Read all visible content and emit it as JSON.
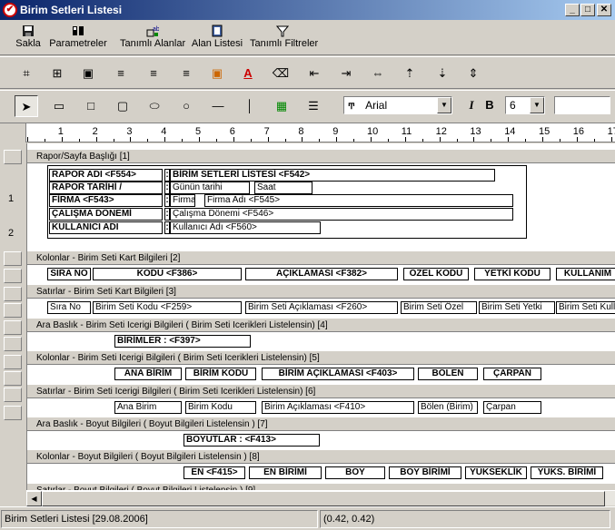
{
  "window": {
    "title": "Birim Setleri Listesi"
  },
  "toolbar_main": [
    {
      "label": "Sakla",
      "icon": "save-icon"
    },
    {
      "label": "Parametreler",
      "icon": "parameters-icon"
    },
    {
      "label": "Tanımlı Alanlar",
      "icon": "defined-fields-icon"
    },
    {
      "label": "Alan Listesi",
      "icon": "field-list-icon"
    },
    {
      "label": "Tanımlı Filtreler",
      "icon": "filter-icon"
    }
  ],
  "font": {
    "name": "Arial",
    "size": "6",
    "italic_label": "I",
    "bold_label": "B",
    "color_label": "A"
  },
  "ruler": {
    "h": [
      "1",
      "2",
      "3",
      "4",
      "5",
      "6",
      "7",
      "8",
      "9",
      "10",
      "11",
      "12",
      "13",
      "14",
      "15",
      "16",
      "17"
    ],
    "v": [
      "1",
      "2"
    ]
  },
  "report": {
    "header_band": "Rapor/Sayfa Başlığı [1]",
    "header_rows": [
      {
        "label": "RAPOR ADI <F554>",
        "value": "BİRİM SETLERİ LİSTESİ <F542>"
      },
      {
        "label": "RAPOR TARİHİ /",
        "value": "Günün tarihi",
        "extra": "Saat"
      },
      {
        "label": "FİRMA <F543>",
        "value": "Firma",
        "extra": "Firma Adı <F545>"
      },
      {
        "label": "ÇALIŞMA DÖNEMİ",
        "value": "Çalışma Dönemi <F546>"
      },
      {
        "label": "KULLANICI ADI",
        "value": "Kullanıcı Adı <F560>"
      }
    ],
    "bands": [
      {
        "title": "Kolonlar - Birim Seti Kart Bilgileri [2]",
        "fields": [
          "SIRA NO",
          "KODU <F386>",
          "AÇIKLAMASI <F382>",
          "ÖZEL KODU",
          "YETKİ KODU",
          "KULLANIM"
        ]
      },
      {
        "title": "Satırlar - Birim Seti Kart Bilgileri [3]",
        "fields": [
          "Sıra No",
          "Birim Seti Kodu <F259>",
          "Birim Seti Açıklaması <F260>",
          "Birim Seti Özel",
          "Birim Seti Yetki",
          "Birim Seti Kull"
        ]
      },
      {
        "title": "Ara Baslık - Birim Seti Icerigi Bilgileri ( Birim Seti Icerikleri Listelensin) [4]",
        "fields": [
          "BİRİMLER : <F397>"
        ]
      },
      {
        "title": "Kolonlar - Birim Seti Icerigi Bilgileri ( Birim Seti Icerikleri Listelensin) [5]",
        "fields": [
          "ANA BİRİM",
          "BİRİM KODU",
          "BİRİM AÇIKLAMASI <F403>",
          "BÖLEN",
          "ÇARPAN"
        ]
      },
      {
        "title": "Satırlar - Birim Seti Icerigi Bilgileri ( Birim Seti Icerikleri Listelensin) [6]",
        "fields": [
          "Ana Birim",
          "Birim Kodu",
          "Birim Açıklaması <F410>",
          "Bölen (Birim)",
          "Çarpan"
        ]
      },
      {
        "title": "Ara Baslık - Boyut Bilgileri ( Boyut Bilgileri Listelensin ) [7]",
        "fields": [
          "BOYUTLAR : <F413>"
        ]
      },
      {
        "title": "Kolonlar - Boyut Bilgileri ( Boyut Bilgileri Listelensin ) [8]",
        "fields": [
          "EN <F415>",
          "EN BİRİMİ",
          "BOY",
          "BOY BİRİMİ",
          "YÜKSEKLİK",
          "YÜKS. BİRİMİ"
        ]
      },
      {
        "title": "Satırlar - Boyut Bilgileri ( Boyut Bilgileri Listelensin ) [9]",
        "fields": []
      }
    ]
  },
  "status": {
    "left": "Birim Setleri Listesi [29.08.2006]",
    "coords": "(0.42, 0.42)"
  }
}
